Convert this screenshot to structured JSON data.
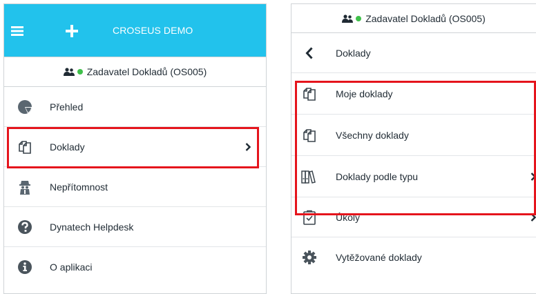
{
  "left_panel": {
    "app_title": "CROSEUS DEMO",
    "user_label": "Zadavatel Dokladů (OS005)",
    "menu": [
      {
        "label": "Přehled",
        "icon": "pie-chart-icon",
        "has_arrow": false
      },
      {
        "label": "Doklady",
        "icon": "documents-icon",
        "has_arrow": true,
        "highlighted": true
      },
      {
        "label": "Nepřítomnost",
        "icon": "absence-icon",
        "has_arrow": false
      },
      {
        "label": "Dynatech Helpdesk",
        "icon": "help-icon",
        "has_arrow": false
      },
      {
        "label": "O aplikaci",
        "icon": "info-icon",
        "has_arrow": false
      }
    ]
  },
  "right_panel": {
    "user_label": "Zadavatel Dokladů (OS005)",
    "back_label": "Doklady",
    "menu": [
      {
        "label": "Moje doklady",
        "icon": "documents-icon",
        "has_arrow": false,
        "highlighted": true
      },
      {
        "label": "Všechny doklady",
        "icon": "documents-icon",
        "has_arrow": false,
        "highlighted": true
      },
      {
        "label": "Doklady podle typu",
        "icon": "binders-icon",
        "has_arrow": true,
        "highlighted": true
      },
      {
        "label": "Úkoly",
        "icon": "clipboard-check-icon",
        "has_arrow": true
      },
      {
        "label": "Vytěžované doklady",
        "icon": "gear-icon",
        "has_arrow": false
      }
    ]
  },
  "colors": {
    "header": "#22c2ec",
    "online": "#3fc04a",
    "highlight": "#e5141c"
  }
}
